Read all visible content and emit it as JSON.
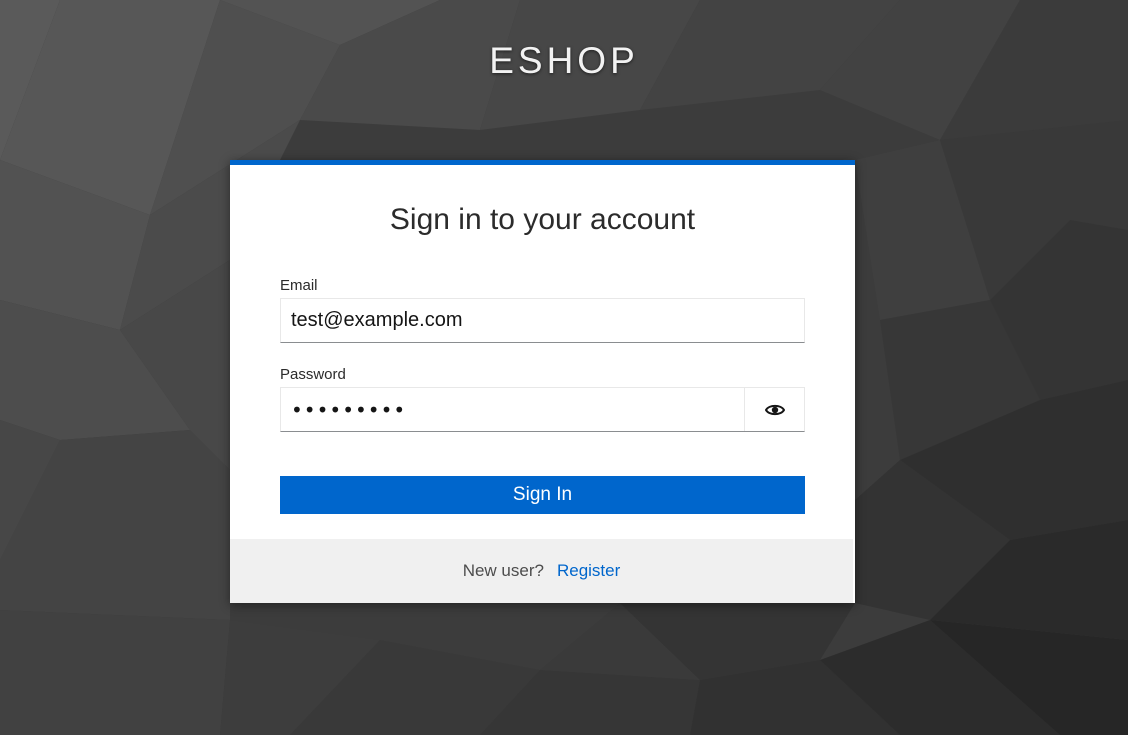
{
  "brand": {
    "title": "ESHOP"
  },
  "login": {
    "heading": "Sign in to your account",
    "email_label": "Email",
    "email_value": "test@example.com",
    "password_label": "Password",
    "password_value": "•••••••••",
    "show_password_icon": "eye-icon",
    "submit_label": "Sign In"
  },
  "footer": {
    "prompt": "New user?",
    "register_link": "Register"
  },
  "colors": {
    "accent": "#0066cc",
    "background": "#3a3a3a",
    "footer_background": "#f0f0f0"
  }
}
